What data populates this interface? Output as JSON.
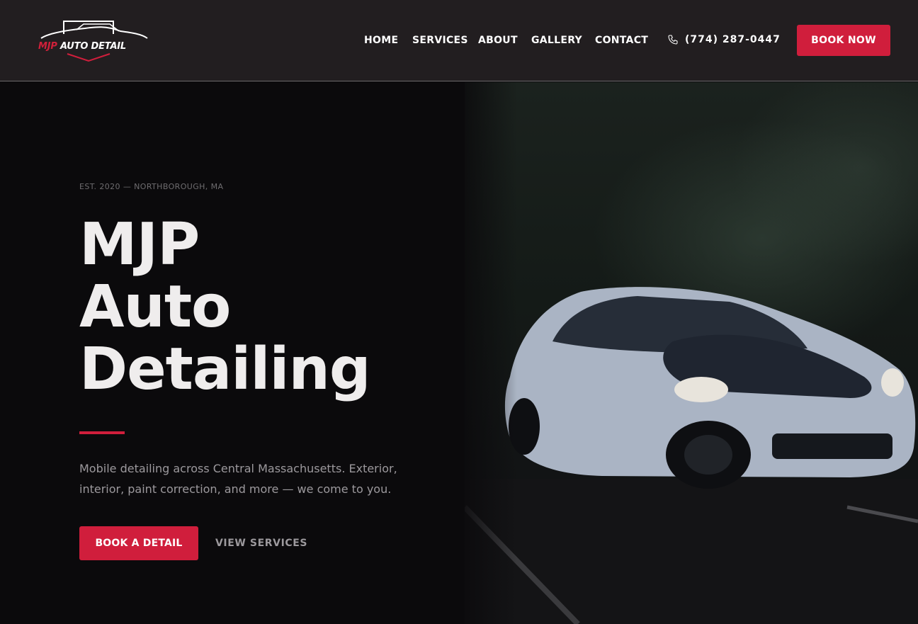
{
  "header": {
    "logo": {
      "brand_red": "MJP",
      "brand_white": "AUTO DETAIL"
    },
    "nav": [
      {
        "label": "HOME"
      },
      {
        "label": "SERVICES"
      },
      {
        "label": "ABOUT"
      },
      {
        "label": "GALLERY"
      },
      {
        "label": "CONTACT"
      }
    ],
    "phone": "(774) 287-0447",
    "cta": "BOOK NOW"
  },
  "hero": {
    "eyebrow": "EST. 2020 — NORTHBOROUGH, MA",
    "title_lines": [
      "MJP",
      "Auto",
      "Detailing"
    ],
    "description": "Mobile detailing across Central Massachusetts. Exterior, interior, paint correction, and more — we come to you.",
    "primary_cta": "BOOK A DETAIL",
    "secondary_cta": "VIEW SERVICES"
  },
  "colors": {
    "accent": "#d01e3c",
    "header_bg": "#221e20",
    "page_bg": "#0b0a0c",
    "muted_text": "#9c999d"
  },
  "icons": {
    "phone": "phone-icon",
    "logo_car": "car-silhouette-icon"
  }
}
